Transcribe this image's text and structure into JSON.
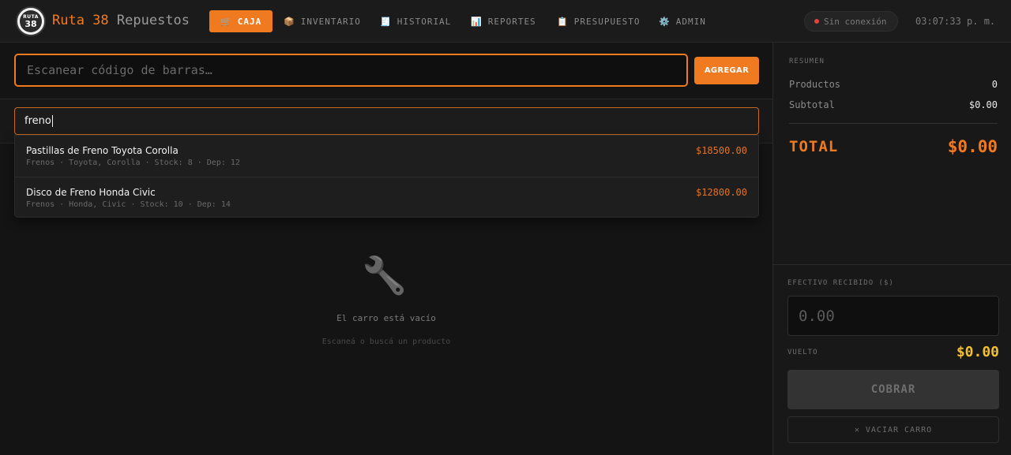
{
  "header": {
    "logo": {
      "line1": "RUTA",
      "line2": "38"
    },
    "brand": {
      "name_accent": "Ruta 38",
      "name_rest": "Repuestos"
    },
    "nav": [
      {
        "icon": "🛒",
        "label": "CAJA",
        "active": true
      },
      {
        "icon": "📦",
        "label": "INVENTARIO",
        "active": false
      },
      {
        "icon": "🧾",
        "label": "HISTORIAL",
        "active": false
      },
      {
        "icon": "📊",
        "label": "REPORTES",
        "active": false
      },
      {
        "icon": "📋",
        "label": "PRESUPUESTO",
        "active": false
      },
      {
        "icon": "⚙️",
        "label": "ADMIN",
        "active": false
      }
    ],
    "status": "Sin conexión",
    "clock": "03:07:33 p. m."
  },
  "scanner": {
    "placeholder": "Escanear código de barras…",
    "add_label": "AGREGAR"
  },
  "search": {
    "value": "freno",
    "results": [
      {
        "name": "Pastillas de Freno Toyota Corolla",
        "meta": "Frenos · Toyota, Corolla · Stock: 8 · Dep: 12",
        "price": "$18500.00"
      },
      {
        "name": "Disco de Freno Honda Civic",
        "meta": "Frenos · Honda, Civic · Stock: 10 · Dep: 14",
        "price": "$12800.00"
      }
    ]
  },
  "cart": {
    "icon": "🔧",
    "empty_title": "El carro está vacío",
    "empty_subtitle": "Escaneá o buscá un producto"
  },
  "summary": {
    "label": "RESUMEN",
    "products_label": "Productos",
    "products_value": "0",
    "subtotal_label": "Subtotal",
    "subtotal_value": "$0.00",
    "total_label": "TOTAL",
    "total_value": "$0.00"
  },
  "payment": {
    "cash_label": "EFECTIVO RECIBIDO ($)",
    "cash_placeholder": "0.00",
    "change_label": "VUELTO",
    "change_value": "$0.00",
    "charge_label": "COBRAR",
    "clear_label": "✕ VACIAR CARRO"
  },
  "colors": {
    "accent": "#f07a20",
    "change": "#f0c030",
    "offline": "#e0443a"
  }
}
